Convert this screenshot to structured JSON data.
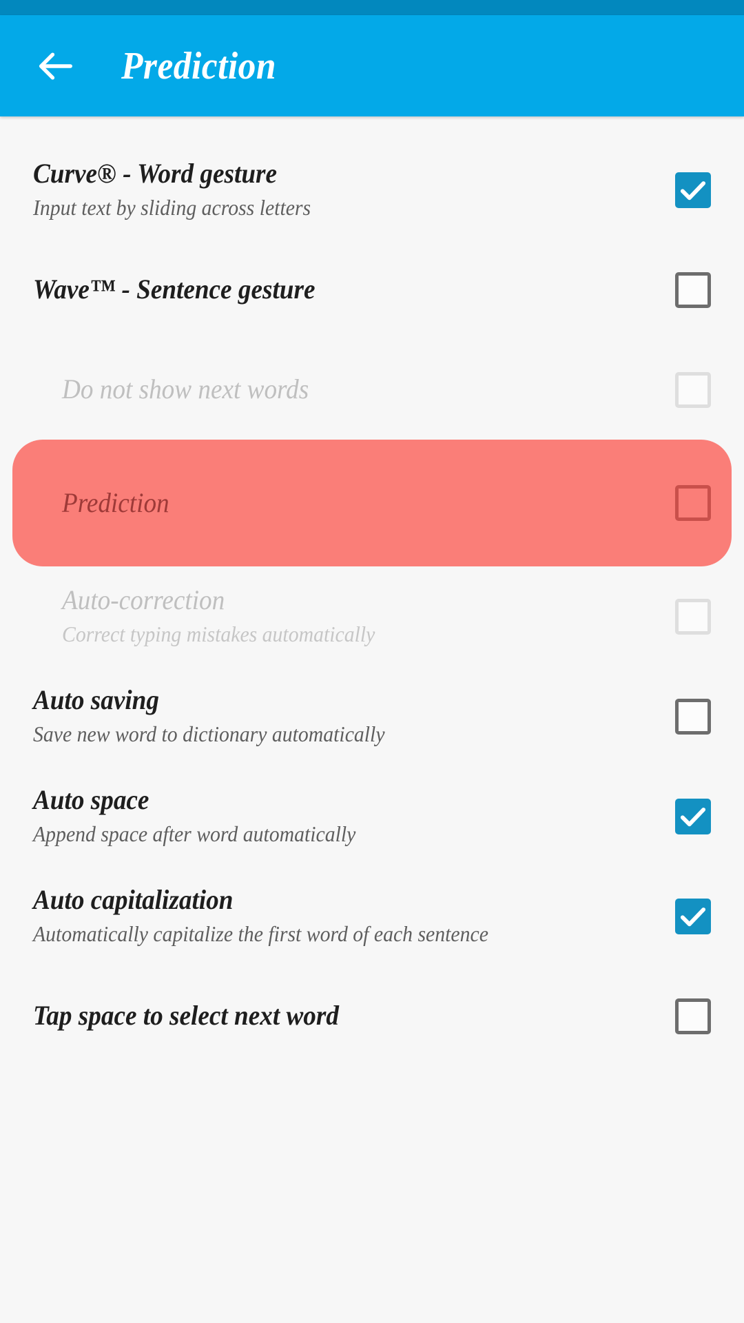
{
  "theme": {
    "status_bar_color": "#0288BE",
    "app_bar_color": "#03A9E8",
    "page_background": "#F7F7F7",
    "accent_checked": "#1391C2",
    "highlight_color": "#FA7E78",
    "highlight_text_color": "#9E3A38"
  },
  "app_bar": {
    "back_icon": "back-arrow-icon",
    "title": "Prediction"
  },
  "settings": [
    {
      "title": "Curve® - Word gesture",
      "subtitle": "Input text by sliding across letters",
      "checked": true,
      "state": "enabled",
      "indent": false
    },
    {
      "title": "Wave™ - Sentence gesture",
      "subtitle": "",
      "checked": false,
      "state": "enabled",
      "indent": false
    },
    {
      "title": "Do not show next words",
      "subtitle": "",
      "checked": false,
      "state": "disabled",
      "indent": true
    },
    {
      "title": "Prediction",
      "subtitle": "",
      "checked": false,
      "state": "highlighted",
      "indent": false
    },
    {
      "title": "Auto-correction",
      "subtitle": "Correct typing mistakes automatically",
      "checked": false,
      "state": "disabled",
      "indent": true
    },
    {
      "title": "Auto saving",
      "subtitle": "Save new word to dictionary automatically",
      "checked": false,
      "state": "enabled",
      "indent": false
    },
    {
      "title": "Auto space",
      "subtitle": "Append space after word automatically",
      "checked": true,
      "state": "enabled",
      "indent": false
    },
    {
      "title": "Auto capitalization",
      "subtitle": "Automatically capitalize the first word of each sentence",
      "checked": true,
      "state": "enabled",
      "indent": false
    },
    {
      "title": "Tap space to select next word",
      "subtitle": "",
      "checked": false,
      "state": "enabled",
      "indent": false
    }
  ]
}
